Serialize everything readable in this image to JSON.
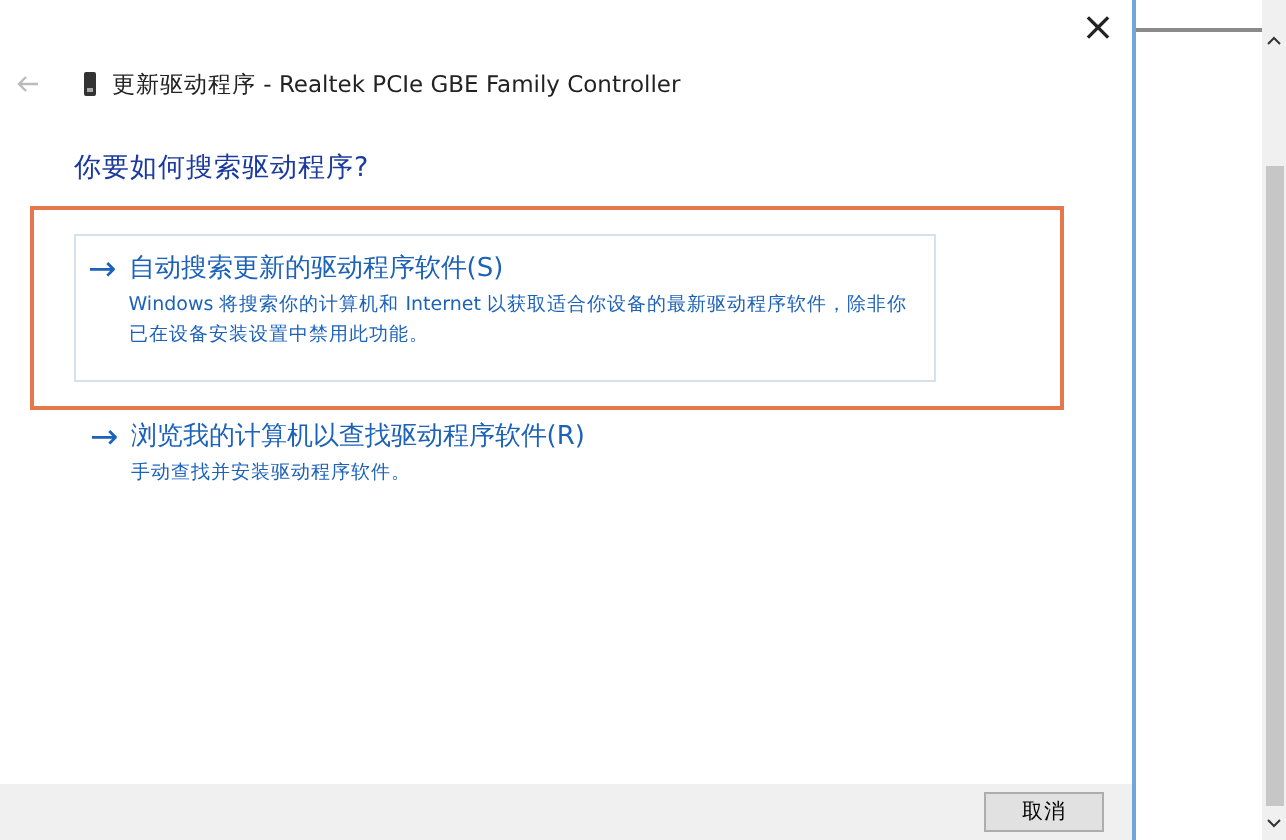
{
  "window": {
    "close": "×",
    "title": "更新驱动程序 - Realtek PCIe GBE Family Controller"
  },
  "heading": "你要如何搜索驱动程序?",
  "options": [
    {
      "arrow": "→",
      "label": "自动搜索更新的驱动程序软件(S)",
      "description": "Windows 将搜索你的计算机和 Internet 以获取适合你设备的最新驱动程序软件，除非你已在设备安装设置中禁用此功能。",
      "selected": true
    },
    {
      "arrow": "→",
      "label": "浏览我的计算机以查找驱动程序软件(R)",
      "description": "手动查找并安装驱动程序软件。",
      "selected": false
    }
  ],
  "buttons": [
    "取消"
  ]
}
